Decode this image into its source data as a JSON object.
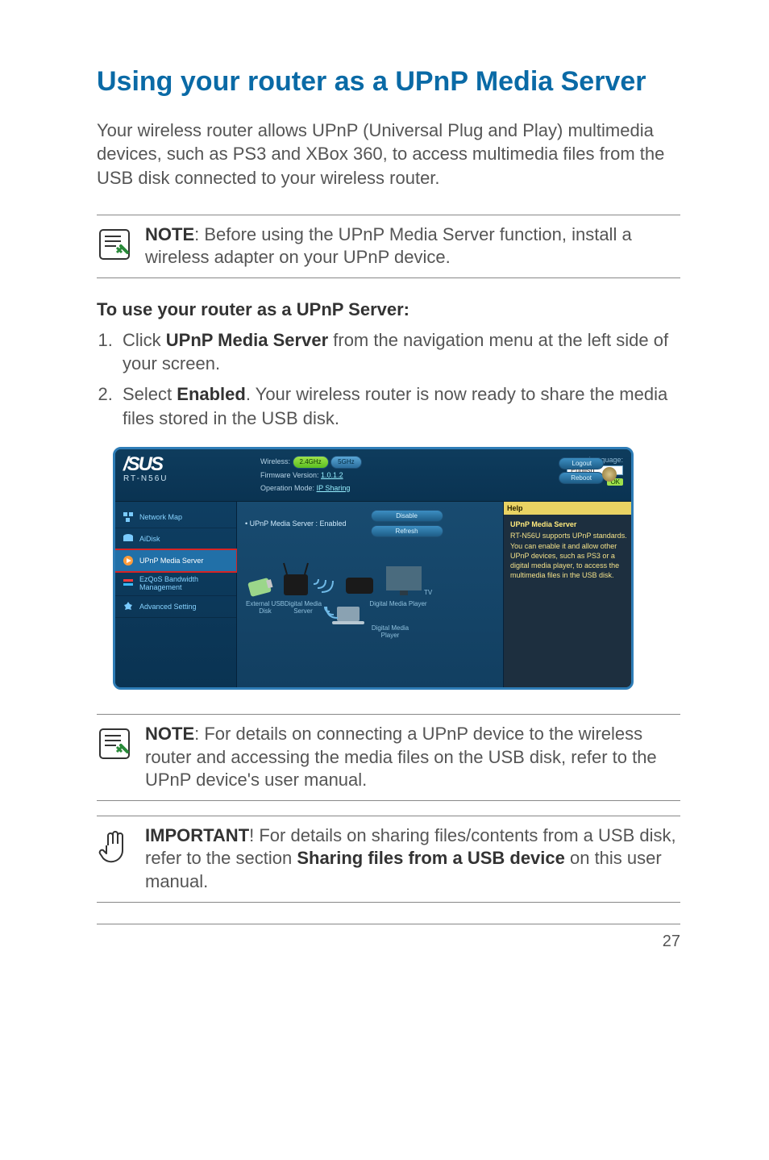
{
  "page_number": "27",
  "title": "Using your router as a UPnP Media Server",
  "intro": "Your wireless router allows UPnP (Universal Plug and Play) multimedia devices, such as PS3 and XBox 360, to access multimedia files from the USB disk connected to your wireless router.",
  "note1_bold": "NOTE",
  "note1_text": ": Before using the UPnP Media Server function, install a wireless adapter on your UPnP device.",
  "subhead": "To use your router as a UPnP Server:",
  "step1_pre": "Click ",
  "step1_bold": "UPnP Media Server",
  "step1_post": " from the navigation menu at the left side of your screen.",
  "step2_pre": "Select ",
  "step2_bold": "Enabled",
  "step2_post": ". Your wireless router is now ready to share the media files stored in the USB disk.",
  "note2_bold": "NOTE",
  "note2_text": ": For details on connecting a UPnP device to the wireless router and accessing the media files on the USB disk, refer to the UPnP device's user manual.",
  "important_bold": "IMPORTANT",
  "important_mid": "! For details on sharing files/contents from a USB disk, refer to the section ",
  "important_bold2": "Sharing files from a USB device",
  "important_post": " on this user manual.",
  "router": {
    "brand": "/SUS",
    "model": "RT-N56U",
    "wireless_label": "Wireless:",
    "band24": "2.4GHz",
    "band5": "5GHz",
    "fw_label": "Firmware Version:",
    "fw_value": "1.0.1.2",
    "op_label": "Operation Mode:",
    "op_value": "IP Sharing",
    "lang_label": "Language:",
    "lang_value": "English",
    "ok": "OK",
    "logout": "Logout",
    "reboot": "Reboot",
    "sidebar": {
      "network_map": "Network Map",
      "aidisk": "AiDisk",
      "upnp": "UPnP Media Server",
      "ezqos": "EzQoS Bandwidth Management",
      "advanced": "Advanced Setting"
    },
    "main": {
      "status": "UPnP Media Server : Enabled",
      "disable": "Disable",
      "refresh": "Refresh",
      "ext_usb": "External USB Disk",
      "dms": "Digital Media Server",
      "dmp": "Digital Media Player",
      "dmp2": "Digital Media Player",
      "tv": "TV"
    },
    "help": {
      "title": "Help",
      "sub": "UPnP Media Server",
      "body": "RT-N56U supports UPnP standards. You can enable it and allow other UPnP devices, such as PS3 or a digital media player, to access the multimedia files in the USB disk."
    }
  }
}
